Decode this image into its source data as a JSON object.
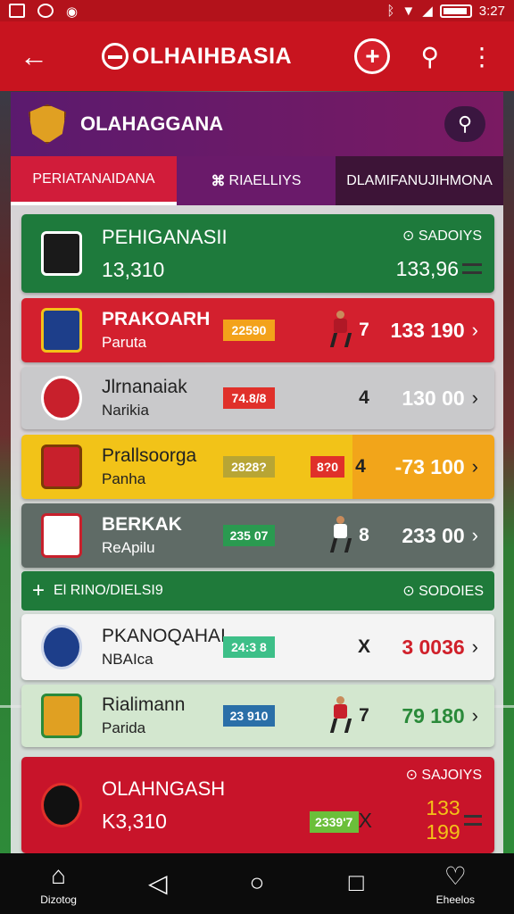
{
  "status_bar": {
    "time": "3:27"
  },
  "app_bar": {
    "title": "OLHAIHBASIA",
    "back_icon": "arrow-left-icon",
    "add_icon": "plus-circle-icon",
    "search_icon": "search-icon",
    "more_icon": "more-vertical-icon"
  },
  "league": {
    "name": "OLAHAGGANA"
  },
  "tabs": [
    {
      "label": "PERIATANAIDANA"
    },
    {
      "label": "RIAELLIYS"
    },
    {
      "label": "DLAMIFANUJIHMONA"
    }
  ],
  "featured": [
    {
      "team": "PEHIGANASII",
      "score": "13,310",
      "sub": "⊙ SADOIYS",
      "odds": "133,96",
      "colors": {
        "bg": "#1e7a3c",
        "logo": "#1a1a1a"
      }
    },
    {
      "team": "OLAHNGASH",
      "score": "K3,310",
      "sub": "⊙ SAJOIYS",
      "mark": "X",
      "odds": "133 199",
      "odd_box": "2339'7",
      "colors": {
        "bg": "#c8142a",
        "logo": "#111111"
      }
    }
  ],
  "section": {
    "label": "El RINO/DIELSI9",
    "right": "⊙ SODOIES"
  },
  "matches": [
    {
      "name": "PRAKOARH",
      "sub": "Paruta",
      "odd": "22590",
      "mark": "7",
      "score": "133 190",
      "bg": "#d3202e",
      "text": "#ffffff",
      "odd_bg": "#f3a21a",
      "odd_fg": "#ffffff",
      "logo": "#1d3e8a",
      "shirt": "#b01826"
    },
    {
      "name": "Jlrnanaiak",
      "sub": "Narikia",
      "odd": "74.8/8",
      "mark": "4",
      "score": "130 00",
      "bg": "#c9c9cb",
      "text": "#222222",
      "odd_bg": "#e0302a",
      "odd_fg": "#ffffff",
      "logo": "#c8202c",
      "shirt": ""
    },
    {
      "name": "Prallsoorga",
      "sub": "Panha",
      "odd": "2828?",
      "odd2": "8?0",
      "mark": "4",
      "score": "-73 100",
      "bg": "#f2c318",
      "text": "#222222",
      "odd_bg": "#b8a534",
      "odd_fg": "#ffffff",
      "logo": "#c8202c",
      "shirt": ""
    },
    {
      "name": "BERKAK",
      "sub": "ReApilu",
      "odd": "235 07",
      "mark": "8",
      "score": "233 00",
      "bg": "#5f6b66",
      "text": "#ffffff",
      "odd_bg": "#2a9a50",
      "odd_fg": "#ffffff",
      "logo": "#ffffff",
      "shirt": "#ffffff"
    },
    {
      "name": "PKANOQAHAI",
      "sub": "NBAIca",
      "odd": "24:3 8",
      "mark": "X",
      "score": "3 0036",
      "bg": "#f4f4f4",
      "text": "#222222",
      "odd_bg": "#3dbf88",
      "odd_fg": "#ffffff",
      "logo": "#1d3e8a",
      "score_color": "#d0202a"
    },
    {
      "name": "Rialimann",
      "sub": "Parida",
      "odd": "23 910",
      "mark": "7",
      "score": "79 180",
      "bg": "#d3e7cf",
      "text": "#222222",
      "odd_bg": "#2a6fa8",
      "odd_fg": "#ffffff",
      "logo": "#e0a022",
      "shirt": "#c8202c",
      "score_color": "#2a8a3a"
    }
  ],
  "nav": [
    {
      "icon": "home-icon",
      "label": "Dizotog"
    },
    {
      "icon": "back-triangle-icon",
      "label": ""
    },
    {
      "icon": "circle-home-icon",
      "label": ""
    },
    {
      "icon": "square-recents-icon",
      "label": ""
    },
    {
      "icon": "heart-icon",
      "label": "Eheelos"
    }
  ]
}
